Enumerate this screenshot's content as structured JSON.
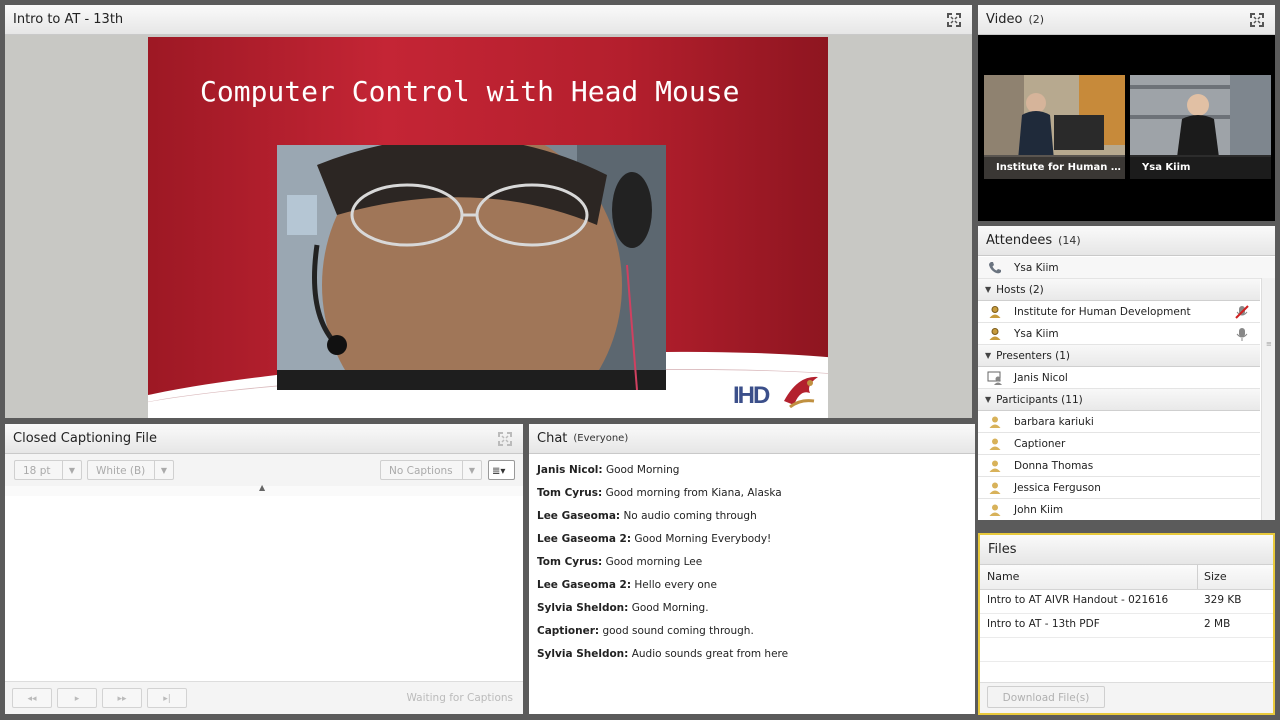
{
  "share": {
    "title": "Intro to AT - 13th",
    "slide_title": "Computer Control with Head Mouse",
    "logo_text": "IHD"
  },
  "video": {
    "title": "Video",
    "count": "(2)",
    "tiles": [
      {
        "name": "Institute for Human D..."
      },
      {
        "name": "Ysa Kiim"
      }
    ]
  },
  "attendees": {
    "title": "Attendees",
    "count": "(14)",
    "me": "Ysa Kiim",
    "hosts_label": "Hosts (2)",
    "hosts": [
      "Institute for Human Development",
      "Ysa Kiim"
    ],
    "presenters_label": "Presenters (1)",
    "presenters": [
      "Janis Nicol"
    ],
    "participants_label": "Participants (11)",
    "participants": [
      "barbara kariuki",
      "Captioner",
      "Donna Thomas",
      "Jessica Ferguson",
      "John Kiim"
    ]
  },
  "cc": {
    "title": "Closed Captioning File",
    "font_size": "18 pt",
    "color": "White (B)",
    "captions": "No Captions",
    "status": "Waiting for Captions"
  },
  "chat": {
    "title": "Chat",
    "scope": "(Everyone)",
    "messages": [
      {
        "from": "Janis Nicol:",
        "text": " Good Morning"
      },
      {
        "from": "Tom Cyrus:",
        "text": " Good morning from Kiana, Alaska"
      },
      {
        "from": "Lee Gaseoma:",
        "text": " No audio coming through"
      },
      {
        "from": "Lee Gaseoma 2:",
        "text": " Good Morning Everybody!"
      },
      {
        "from": "Tom Cyrus:",
        "text": " Good morning Lee"
      },
      {
        "from": "Lee Gaseoma 2:",
        "text": " Hello every one"
      },
      {
        "from": "Sylvia Sheldon:",
        "text": " Good Morning."
      },
      {
        "from": "Captioner:",
        "text": " good sound coming through."
      },
      {
        "from": "Sylvia Sheldon:",
        "text": " Audio sounds great from here"
      }
    ]
  },
  "files": {
    "title": "Files",
    "col_name": "Name",
    "col_size": "Size",
    "rows": [
      {
        "name": "Intro to AT AIVR Handout - 021616",
        "size": "329 KB"
      },
      {
        "name": "Intro to AT - 13th PDF",
        "size": "2 MB"
      }
    ],
    "download_label": "Download File(s)"
  },
  "colors": {
    "accent_border": "#e8c93c",
    "slide_red": "#b3212e"
  }
}
